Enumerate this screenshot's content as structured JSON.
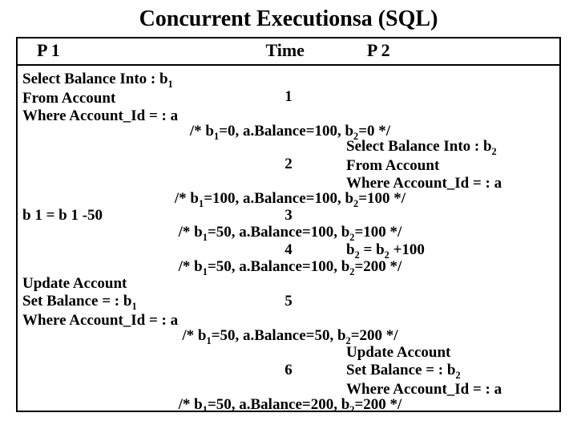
{
  "title": "Concurrent Executionsa (SQL)",
  "headers": {
    "p1": "P 1",
    "time": "Time",
    "p2": "P 2"
  },
  "p1": {
    "s1a": "Select Balance Into : b",
    "s1b": "From Account",
    "s1c": "Where Account_Id = : a",
    "s2": "b 1 = b 1 -50",
    "s3a": "Update Account",
    "s3b": "Set Balance = : b",
    "s3c": "Where Account_Id = : a"
  },
  "p2": {
    "s1a": "Select Balance Into : b",
    "s1b": "From Account",
    "s1c": "Where Account_Id = : a",
    "s2pre": "b",
    "s2mid": " = b",
    "s2post": " +100",
    "s3a": "Update Account",
    "s3b": "Set Balance = : b",
    "s3c": "Where Account_Id = : a"
  },
  "time": {
    "t1": "1",
    "t2": "2",
    "t3": "3",
    "t4": "4",
    "t5": "5",
    "t6": "6"
  },
  "st": {
    "s1a": "/* b",
    "s1b": "=0, a.Balance=100, b",
    "s1c": "=0 */",
    "s2a": "/* b",
    "s2b": "=100, a.Balance=100, b",
    "s2c": "=100 */",
    "s3a": "/* b",
    "s3b": "=50, a.Balance=100, b",
    "s3c": "=100 */",
    "s4a": "/* b",
    "s4b": "=50, a.Balance=100, b",
    "s4c": "=200 */",
    "s5a": "/* b",
    "s5b": "=50, a.Balance=50, b",
    "s5c": "=200 */",
    "s6a": "/* b",
    "s6b": "=50, a.Balance=200, b",
    "s6c": "=200 */"
  },
  "sub": {
    "one": "1",
    "two": "2"
  }
}
